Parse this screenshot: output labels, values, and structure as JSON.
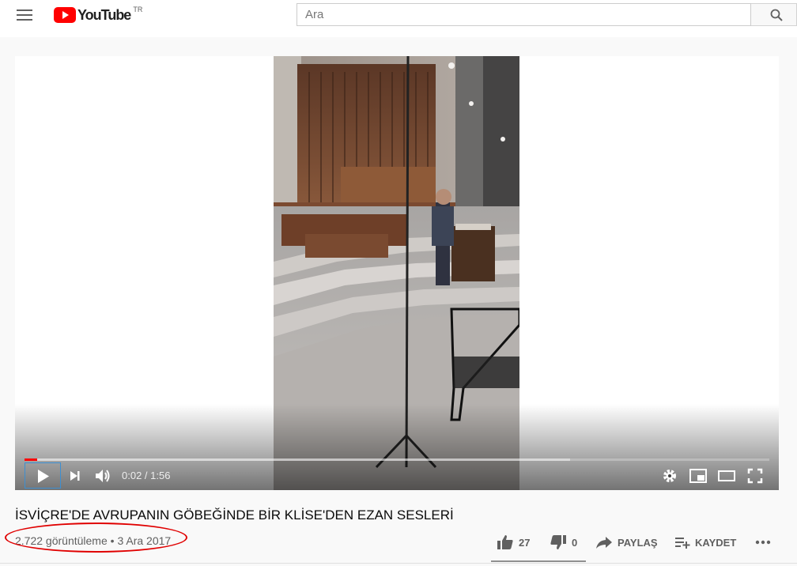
{
  "header": {
    "logo_text": "YouTube",
    "country_code": "TR",
    "search_placeholder": "Ara"
  },
  "player": {
    "time_current": "0:02",
    "time_separator": " / ",
    "time_total": "1:56",
    "played_fraction": 0.017,
    "buffered_fraction": 0.732
  },
  "video": {
    "title": "İSVİÇRE'DE AVRUPANIN GÖBEĞİNDE BİR KLİSE'DEN EZAN SESLERİ",
    "views": "2.722 görüntüleme",
    "separator": " • ",
    "date": "3 Ara 2017"
  },
  "actions": {
    "likes": "27",
    "dislikes": "0",
    "share_label": "PAYLAŞ",
    "save_label": "KAYDET"
  },
  "colors": {
    "brand_red": "#ff0000",
    "annotation_circle": "#e00000"
  }
}
